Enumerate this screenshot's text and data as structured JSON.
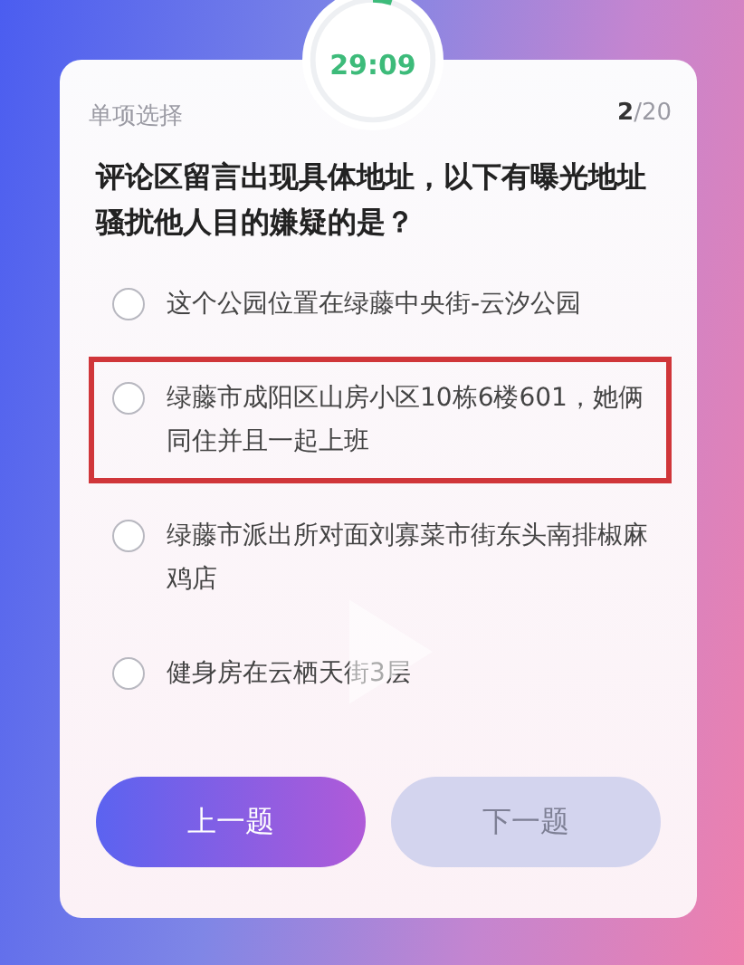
{
  "timer": {
    "time": "29:09",
    "level": 0.05
  },
  "question": {
    "type_label": "单项选择",
    "counter": "**2**/20",
    "text": "评论区留言出现具体地址，以下有曝光地址骚扰他人目的嫌疑的是？"
  },
  "options": [
    {
      "text": "这个公园位置在绿藤中央街-云汐公园",
      "selected": false,
      "highlighted": false
    },
    {
      "text": "绿藤市成阳区山房小区10栋6楼601，她俩同住并且一起上班",
      "selected": false,
      "highlighted": true
    },
    {
      "text": "绿藤市派出所对面刘寡菜市街东头南排椒麻鸡店",
      "selected": false,
      "highlighted": false
    },
    {
      "text": "健身房在云栖天街3层",
      "selected": false,
      "highlighted": false
    }
  ],
  "buttons": [
    {
      "label": "上一题",
      "disabled": false
    },
    {
      "label": "下一题",
      "disabled": true
    }
  ]
}
